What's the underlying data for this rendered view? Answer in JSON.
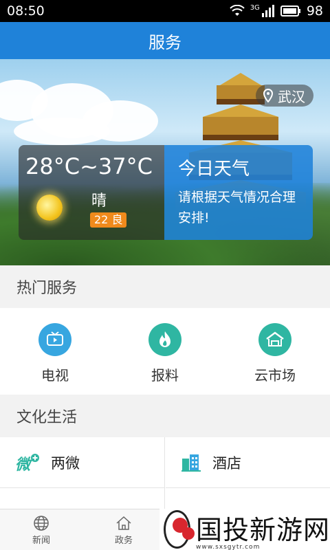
{
  "status_bar": {
    "time": "08:50",
    "network": "3G",
    "battery": "98"
  },
  "app_bar": {
    "title": "服务"
  },
  "hero": {
    "location": "武汉",
    "weather": {
      "temperature": "28°C~37°C",
      "condition": "晴",
      "aqi": "22 良"
    },
    "today": {
      "title": "今日天气",
      "text": "请根据天气情况合理安排!"
    }
  },
  "hot_services": {
    "title": "热门服务",
    "items": [
      {
        "label": "电视",
        "icon": "tv-icon"
      },
      {
        "label": "报料",
        "icon": "fire-icon"
      },
      {
        "label": "云市场",
        "icon": "market-icon"
      }
    ]
  },
  "culture": {
    "title": "文化生活",
    "items": [
      {
        "label": "两微",
        "icon": "weibo-plus-icon"
      },
      {
        "label": "酒店",
        "icon": "hotel-icon"
      }
    ]
  },
  "tab_bar": {
    "tabs": [
      {
        "label": "新闻",
        "icon": "globe-icon"
      },
      {
        "label": "政务",
        "icon": "home-icon"
      }
    ]
  },
  "watermark": {
    "text": "国投新游网",
    "url": "www.sxsgytr.com"
  },
  "colors": {
    "primary": "#1f82d9",
    "teal": "#2fb6a2",
    "aqi_badge": "#f08a1c"
  }
}
